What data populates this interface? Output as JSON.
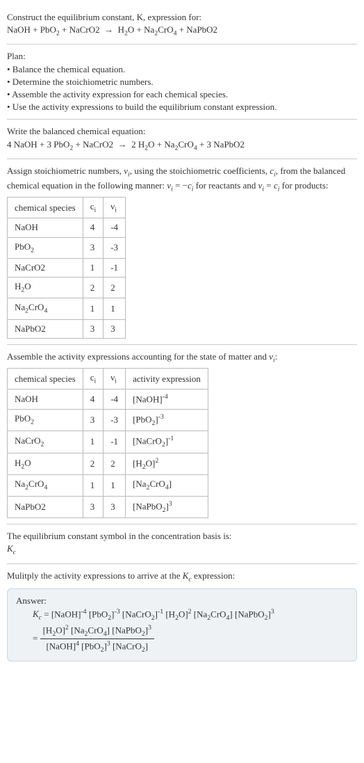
{
  "s1": {
    "line1": "Construct the equilibrium constant, K, expression for:",
    "line2_html": "NaOH + PbO<sub>2</sub> + NaCrO2 &nbsp;&rarr;&nbsp; H<sub>2</sub>O + Na<sub>2</sub>CrO<sub>4</sub> + NaPbO2"
  },
  "s2": {
    "plan": "Plan:",
    "b1": "• Balance the chemical equation.",
    "b2": "• Determine the stoichiometric numbers.",
    "b3": "• Assemble the activity expression for each chemical species.",
    "b4": "• Use the activity expressions to build the equilibrium constant expression."
  },
  "s3": {
    "line1": "Write the balanced chemical equation:",
    "line2_html": "4 NaOH + 3 PbO<sub>2</sub> + NaCrO2 &nbsp;&rarr;&nbsp; 2 H<sub>2</sub>O + Na<sub>2</sub>CrO<sub>4</sub> + 3 NaPbO2"
  },
  "s4": {
    "intro_html": "Assign stoichiometric numbers, <span class='italic'>&nu;<sub>i</sub></span>, using the stoichiometric coefficients, <span class='italic'>c<sub>i</sub></span>, from the balanced chemical equation in the following manner: <span class='italic'>&nu;<sub>i</sub></span> = &minus;<span class='italic'>c<sub>i</sub></span> for reactants and <span class='italic'>&nu;<sub>i</sub></span> = <span class='italic'>c<sub>i</sub></span> for products:",
    "headers": [
      "chemical species",
      "c<sub>i</sub>",
      "&nu;<sub>i</sub>"
    ],
    "rows": [
      [
        "NaOH",
        "4",
        "-4"
      ],
      [
        "PbO<sub>2</sub>",
        "3",
        "-3"
      ],
      [
        "NaCrO2",
        "1",
        "-1"
      ],
      [
        "H<sub>2</sub>O",
        "2",
        "2"
      ],
      [
        "Na<sub>2</sub>CrO<sub>4</sub>",
        "1",
        "1"
      ],
      [
        "NaPbO2",
        "3",
        "3"
      ]
    ]
  },
  "s5": {
    "intro_html": "Assemble the activity expressions accounting for the state of matter and <span class='italic'>&nu;<sub>i</sub></span>:",
    "headers": [
      "chemical species",
      "c<sub>i</sub>",
      "&nu;<sub>i</sub>",
      "activity expression"
    ],
    "rows": [
      [
        "NaOH",
        "4",
        "-4",
        "[NaOH]<sup>-4</sup>"
      ],
      [
        "PbO<sub>2</sub>",
        "3",
        "-3",
        "[PbO<sub>2</sub>]<sup>-3</sup>"
      ],
      [
        "NaCrO<sub>2</sub>",
        "1",
        "-1",
        "[NaCrO<sub>2</sub>]<sup>-1</sup>"
      ],
      [
        "H<sub>2</sub>O",
        "2",
        "2",
        "[H<sub>2</sub>O]<sup>2</sup>"
      ],
      [
        "Na<sub>2</sub>CrO<sub>4</sub>",
        "1",
        "1",
        "[Na<sub>2</sub>CrO<sub>4</sub>]"
      ],
      [
        "NaPbO2",
        "3",
        "3",
        "[NaPbO<sub>2</sub>]<sup>3</sup>"
      ]
    ]
  },
  "s6": {
    "line1": "The equilibrium constant symbol in the concentration basis is:",
    "line2_html": "<span class='italic'>K<sub>c</sub></span>"
  },
  "s7": {
    "line1_html": "Mulitply the activity expressions to arrive at the <span class='italic'>K<sub>c</sub></span> expression:"
  },
  "answer": {
    "label": "Answer:",
    "line1_html": "<span class='italic'>K<sub>c</sub></span> = [NaOH]<sup>-4</sup> [PbO<sub>2</sub>]<sup>-3</sup> [NaCrO<sub>2</sub>]<sup>-1</sup> [H<sub>2</sub>O]<sup>2</sup> [Na<sub>2</sub>CrO<sub>4</sub>] [NaPbO<sub>2</sub>]<sup>3</sup>",
    "frac_num_html": "[H<sub>2</sub>O]<sup>2</sup> [Na<sub>2</sub>CrO<sub>4</sub>] [NaPbO<sub>2</sub>]<sup>3</sup>",
    "frac_den_html": "[NaOH]<sup>4</sup> [PbO<sub>2</sub>]<sup>3</sup> [NaCrO<sub>2</sub>]"
  },
  "chart_data": {
    "type": "table",
    "tables": [
      {
        "title": "Stoichiometric numbers",
        "columns": [
          "chemical species",
          "c_i",
          "nu_i"
        ],
        "rows": [
          [
            "NaOH",
            4,
            -4
          ],
          [
            "PbO2",
            3,
            -3
          ],
          [
            "NaCrO2",
            1,
            -1
          ],
          [
            "H2O",
            2,
            2
          ],
          [
            "Na2CrO4",
            1,
            1
          ],
          [
            "NaPbO2",
            3,
            3
          ]
        ]
      },
      {
        "title": "Activity expressions",
        "columns": [
          "chemical species",
          "c_i",
          "nu_i",
          "activity expression"
        ],
        "rows": [
          [
            "NaOH",
            4,
            -4,
            "[NaOH]^-4"
          ],
          [
            "PbO2",
            3,
            -3,
            "[PbO2]^-3"
          ],
          [
            "NaCrO2",
            1,
            -1,
            "[NaCrO2]^-1"
          ],
          [
            "H2O",
            2,
            2,
            "[H2O]^2"
          ],
          [
            "Na2CrO4",
            1,
            1,
            "[Na2CrO4]"
          ],
          [
            "NaPbO2",
            3,
            3,
            "[NaPbO2]^3"
          ]
        ]
      }
    ]
  }
}
